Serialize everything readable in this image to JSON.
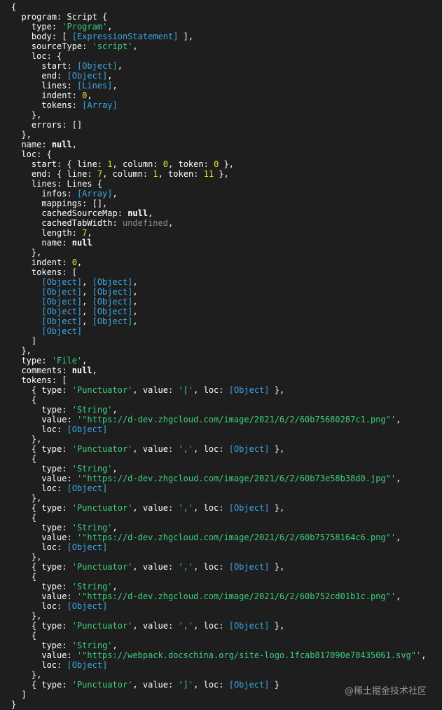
{
  "watermark": "@稀土掘金技术社区",
  "lines": [
    [
      [
        "p",
        "{"
      ]
    ],
    [
      [
        "p",
        "  "
      ],
      [
        "k",
        "program"
      ],
      [
        "p",
        ": Script {"
      ]
    ],
    [
      [
        "p",
        "    "
      ],
      [
        "k",
        "type"
      ],
      [
        "p",
        ": "
      ],
      [
        "s",
        "'Program'"
      ],
      [
        "p",
        ","
      ]
    ],
    [
      [
        "p",
        "    "
      ],
      [
        "k",
        "body"
      ],
      [
        "p",
        ": [ "
      ],
      [
        "r",
        "[ExpressionStatement]"
      ],
      [
        "p",
        " ],"
      ]
    ],
    [
      [
        "p",
        "    "
      ],
      [
        "k",
        "sourceType"
      ],
      [
        "p",
        ": "
      ],
      [
        "s",
        "'script'"
      ],
      [
        "p",
        ","
      ]
    ],
    [
      [
        "p",
        "    "
      ],
      [
        "k",
        "loc"
      ],
      [
        "p",
        ": {"
      ]
    ],
    [
      [
        "p",
        "      "
      ],
      [
        "k",
        "start"
      ],
      [
        "p",
        ": "
      ],
      [
        "r",
        "[Object]"
      ],
      [
        "p",
        ","
      ]
    ],
    [
      [
        "p",
        "      "
      ],
      [
        "k",
        "end"
      ],
      [
        "p",
        ": "
      ],
      [
        "r",
        "[Object]"
      ],
      [
        "p",
        ","
      ]
    ],
    [
      [
        "p",
        "      "
      ],
      [
        "k",
        "lines"
      ],
      [
        "p",
        ": "
      ],
      [
        "r",
        "[Lines]"
      ],
      [
        "p",
        ","
      ]
    ],
    [
      [
        "p",
        "      "
      ],
      [
        "k",
        "indent"
      ],
      [
        "p",
        ": "
      ],
      [
        "n",
        "0"
      ],
      [
        "p",
        ","
      ]
    ],
    [
      [
        "p",
        "      "
      ],
      [
        "k",
        "tokens"
      ],
      [
        "p",
        ": "
      ],
      [
        "r",
        "[Array]"
      ]
    ],
    [
      [
        "p",
        "    },"
      ]
    ],
    [
      [
        "p",
        "    "
      ],
      [
        "k",
        "errors"
      ],
      [
        "p",
        ": []"
      ]
    ],
    [
      [
        "p",
        "  },"
      ]
    ],
    [
      [
        "p",
        "  "
      ],
      [
        "k",
        "name"
      ],
      [
        "p",
        ": "
      ],
      [
        "kw",
        "null"
      ],
      [
        "p",
        ","
      ]
    ],
    [
      [
        "p",
        "  "
      ],
      [
        "k",
        "loc"
      ],
      [
        "p",
        ": {"
      ]
    ],
    [
      [
        "p",
        "    "
      ],
      [
        "k",
        "start"
      ],
      [
        "p",
        ": { "
      ],
      [
        "k",
        "line"
      ],
      [
        "p",
        ": "
      ],
      [
        "n",
        "1"
      ],
      [
        "p",
        ", "
      ],
      [
        "k",
        "column"
      ],
      [
        "p",
        ": "
      ],
      [
        "n",
        "0"
      ],
      [
        "p",
        ", "
      ],
      [
        "k",
        "token"
      ],
      [
        "p",
        ": "
      ],
      [
        "n",
        "0"
      ],
      [
        "p",
        " },"
      ]
    ],
    [
      [
        "p",
        "    "
      ],
      [
        "k",
        "end"
      ],
      [
        "p",
        ": { "
      ],
      [
        "k",
        "line"
      ],
      [
        "p",
        ": "
      ],
      [
        "n",
        "7"
      ],
      [
        "p",
        ", "
      ],
      [
        "k",
        "column"
      ],
      [
        "p",
        ": "
      ],
      [
        "n",
        "1"
      ],
      [
        "p",
        ", "
      ],
      [
        "k",
        "token"
      ],
      [
        "p",
        ": "
      ],
      [
        "n",
        "11"
      ],
      [
        "p",
        " },"
      ]
    ],
    [
      [
        "p",
        "    "
      ],
      [
        "k",
        "lines"
      ],
      [
        "p",
        ": Lines {"
      ]
    ],
    [
      [
        "p",
        "      "
      ],
      [
        "k",
        "infos"
      ],
      [
        "p",
        ": "
      ],
      [
        "r",
        "[Array]"
      ],
      [
        "p",
        ","
      ]
    ],
    [
      [
        "p",
        "      "
      ],
      [
        "k",
        "mappings"
      ],
      [
        "p",
        ": [],"
      ]
    ],
    [
      [
        "p",
        "      "
      ],
      [
        "k",
        "cachedSourceMap"
      ],
      [
        "p",
        ": "
      ],
      [
        "kw",
        "null"
      ],
      [
        "p",
        ","
      ]
    ],
    [
      [
        "p",
        "      "
      ],
      [
        "k",
        "cachedTabWidth"
      ],
      [
        "p",
        ": "
      ],
      [
        "u",
        "undefined"
      ],
      [
        "p",
        ","
      ]
    ],
    [
      [
        "p",
        "      "
      ],
      [
        "k",
        "length"
      ],
      [
        "p",
        ": "
      ],
      [
        "n",
        "7"
      ],
      [
        "p",
        ","
      ]
    ],
    [
      [
        "p",
        "      "
      ],
      [
        "k",
        "name"
      ],
      [
        "p",
        ": "
      ],
      [
        "kw",
        "null"
      ]
    ],
    [
      [
        "p",
        "    },"
      ]
    ],
    [
      [
        "p",
        "    "
      ],
      [
        "k",
        "indent"
      ],
      [
        "p",
        ": "
      ],
      [
        "n",
        "0"
      ],
      [
        "p",
        ","
      ]
    ],
    [
      [
        "p",
        "    "
      ],
      [
        "k",
        "tokens"
      ],
      [
        "p",
        ": ["
      ]
    ],
    [
      [
        "p",
        "      "
      ],
      [
        "r",
        "[Object]"
      ],
      [
        "p",
        ", "
      ],
      [
        "r",
        "[Object]"
      ],
      [
        "p",
        ","
      ]
    ],
    [
      [
        "p",
        "      "
      ],
      [
        "r",
        "[Object]"
      ],
      [
        "p",
        ", "
      ],
      [
        "r",
        "[Object]"
      ],
      [
        "p",
        ","
      ]
    ],
    [
      [
        "p",
        "      "
      ],
      [
        "r",
        "[Object]"
      ],
      [
        "p",
        ", "
      ],
      [
        "r",
        "[Object]"
      ],
      [
        "p",
        ","
      ]
    ],
    [
      [
        "p",
        "      "
      ],
      [
        "r",
        "[Object]"
      ],
      [
        "p",
        ", "
      ],
      [
        "r",
        "[Object]"
      ],
      [
        "p",
        ","
      ]
    ],
    [
      [
        "p",
        "      "
      ],
      [
        "r",
        "[Object]"
      ],
      [
        "p",
        ", "
      ],
      [
        "r",
        "[Object]"
      ],
      [
        "p",
        ","
      ]
    ],
    [
      [
        "p",
        "      "
      ],
      [
        "r",
        "[Object]"
      ]
    ],
    [
      [
        "p",
        "    ]"
      ]
    ],
    [
      [
        "p",
        "  },"
      ]
    ],
    [
      [
        "p",
        "  "
      ],
      [
        "k",
        "type"
      ],
      [
        "p",
        ": "
      ],
      [
        "s",
        "'File'"
      ],
      [
        "p",
        ","
      ]
    ],
    [
      [
        "p",
        "  "
      ],
      [
        "k",
        "comments"
      ],
      [
        "p",
        ": "
      ],
      [
        "kw",
        "null"
      ],
      [
        "p",
        ","
      ]
    ],
    [
      [
        "p",
        "  "
      ],
      [
        "k",
        "tokens"
      ],
      [
        "p",
        ": ["
      ]
    ],
    [
      [
        "p",
        "    { "
      ],
      [
        "k",
        "type"
      ],
      [
        "p",
        ": "
      ],
      [
        "s",
        "'Punctuator'"
      ],
      [
        "p",
        ", "
      ],
      [
        "k",
        "value"
      ],
      [
        "p",
        ": "
      ],
      [
        "s",
        "'['"
      ],
      [
        "p",
        ", "
      ],
      [
        "k",
        "loc"
      ],
      [
        "p",
        ": "
      ],
      [
        "r",
        "[Object]"
      ],
      [
        "p",
        " },"
      ]
    ],
    [
      [
        "p",
        "    {"
      ]
    ],
    [
      [
        "p",
        "      "
      ],
      [
        "k",
        "type"
      ],
      [
        "p",
        ": "
      ],
      [
        "s",
        "'String'"
      ],
      [
        "p",
        ","
      ]
    ],
    [
      [
        "p",
        "      "
      ],
      [
        "k",
        "value"
      ],
      [
        "p",
        ": "
      ],
      [
        "s",
        "'\"https://d-dev.zhgcloud.com/image/2021/6/2/60b75680287c1.png\"'"
      ],
      [
        "p",
        ","
      ]
    ],
    [
      [
        "p",
        "      "
      ],
      [
        "k",
        "loc"
      ],
      [
        "p",
        ": "
      ],
      [
        "r",
        "[Object]"
      ]
    ],
    [
      [
        "p",
        "    },"
      ]
    ],
    [
      [
        "p",
        "    { "
      ],
      [
        "k",
        "type"
      ],
      [
        "p",
        ": "
      ],
      [
        "s",
        "'Punctuator'"
      ],
      [
        "p",
        ", "
      ],
      [
        "k",
        "value"
      ],
      [
        "p",
        ": "
      ],
      [
        "s",
        "','"
      ],
      [
        "p",
        ", "
      ],
      [
        "k",
        "loc"
      ],
      [
        "p",
        ": "
      ],
      [
        "r",
        "[Object]"
      ],
      [
        "p",
        " },"
      ]
    ],
    [
      [
        "p",
        "    {"
      ]
    ],
    [
      [
        "p",
        "      "
      ],
      [
        "k",
        "type"
      ],
      [
        "p",
        ": "
      ],
      [
        "s",
        "'String'"
      ],
      [
        "p",
        ","
      ]
    ],
    [
      [
        "p",
        "      "
      ],
      [
        "k",
        "value"
      ],
      [
        "p",
        ": "
      ],
      [
        "s",
        "'\"https://d-dev.zhgcloud.com/image/2021/6/2/60b73e58b38d0.jpg\"'"
      ],
      [
        "p",
        ","
      ]
    ],
    [
      [
        "p",
        "      "
      ],
      [
        "k",
        "loc"
      ],
      [
        "p",
        ": "
      ],
      [
        "r",
        "[Object]"
      ]
    ],
    [
      [
        "p",
        "    },"
      ]
    ],
    [
      [
        "p",
        "    { "
      ],
      [
        "k",
        "type"
      ],
      [
        "p",
        ": "
      ],
      [
        "s",
        "'Punctuator'"
      ],
      [
        "p",
        ", "
      ],
      [
        "k",
        "value"
      ],
      [
        "p",
        ": "
      ],
      [
        "s",
        "','"
      ],
      [
        "p",
        ", "
      ],
      [
        "k",
        "loc"
      ],
      [
        "p",
        ": "
      ],
      [
        "r",
        "[Object]"
      ],
      [
        "p",
        " },"
      ]
    ],
    [
      [
        "p",
        "    {"
      ]
    ],
    [
      [
        "p",
        "      "
      ],
      [
        "k",
        "type"
      ],
      [
        "p",
        ": "
      ],
      [
        "s",
        "'String'"
      ],
      [
        "p",
        ","
      ]
    ],
    [
      [
        "p",
        "      "
      ],
      [
        "k",
        "value"
      ],
      [
        "p",
        ": "
      ],
      [
        "s",
        "'\"https://d-dev.zhgcloud.com/image/2021/6/2/60b75758164c6.png\"'"
      ],
      [
        "p",
        ","
      ]
    ],
    [
      [
        "p",
        "      "
      ],
      [
        "k",
        "loc"
      ],
      [
        "p",
        ": "
      ],
      [
        "r",
        "[Object]"
      ]
    ],
    [
      [
        "p",
        "    },"
      ]
    ],
    [
      [
        "p",
        "    { "
      ],
      [
        "k",
        "type"
      ],
      [
        "p",
        ": "
      ],
      [
        "s",
        "'Punctuator'"
      ],
      [
        "p",
        ", "
      ],
      [
        "k",
        "value"
      ],
      [
        "p",
        ": "
      ],
      [
        "s",
        "','"
      ],
      [
        "p",
        ", "
      ],
      [
        "k",
        "loc"
      ],
      [
        "p",
        ": "
      ],
      [
        "r",
        "[Object]"
      ],
      [
        "p",
        " },"
      ]
    ],
    [
      [
        "p",
        "    {"
      ]
    ],
    [
      [
        "p",
        "      "
      ],
      [
        "k",
        "type"
      ],
      [
        "p",
        ": "
      ],
      [
        "s",
        "'String'"
      ],
      [
        "p",
        ","
      ]
    ],
    [
      [
        "p",
        "      "
      ],
      [
        "k",
        "value"
      ],
      [
        "p",
        ": "
      ],
      [
        "s",
        "'\"https://d-dev.zhgcloud.com/image/2021/6/2/60b752cd01b1c.png\"'"
      ],
      [
        "p",
        ","
      ]
    ],
    [
      [
        "p",
        "      "
      ],
      [
        "k",
        "loc"
      ],
      [
        "p",
        ": "
      ],
      [
        "r",
        "[Object]"
      ]
    ],
    [
      [
        "p",
        "    },"
      ]
    ],
    [
      [
        "p",
        "    { "
      ],
      [
        "k",
        "type"
      ],
      [
        "p",
        ": "
      ],
      [
        "s",
        "'Punctuator'"
      ],
      [
        "p",
        ", "
      ],
      [
        "k",
        "value"
      ],
      [
        "p",
        ": "
      ],
      [
        "s",
        "','"
      ],
      [
        "p",
        ", "
      ],
      [
        "k",
        "loc"
      ],
      [
        "p",
        ": "
      ],
      [
        "r",
        "[Object]"
      ],
      [
        "p",
        " },"
      ]
    ],
    [
      [
        "p",
        "    {"
      ]
    ],
    [
      [
        "p",
        "      "
      ],
      [
        "k",
        "type"
      ],
      [
        "p",
        ": "
      ],
      [
        "s",
        "'String'"
      ],
      [
        "p",
        ","
      ]
    ],
    [
      [
        "p",
        "      "
      ],
      [
        "k",
        "value"
      ],
      [
        "p",
        ": "
      ],
      [
        "s",
        "'\"https://webpack.docschina.org/site-logo.1fcab817090e78435061.svg\"'"
      ],
      [
        "p",
        ","
      ]
    ],
    [
      [
        "p",
        "      "
      ],
      [
        "k",
        "loc"
      ],
      [
        "p",
        ": "
      ],
      [
        "r",
        "[Object]"
      ]
    ],
    [
      [
        "p",
        "    },"
      ]
    ],
    [
      [
        "p",
        "    { "
      ],
      [
        "k",
        "type"
      ],
      [
        "p",
        ": "
      ],
      [
        "s",
        "'Punctuator'"
      ],
      [
        "p",
        ", "
      ],
      [
        "k",
        "value"
      ],
      [
        "p",
        ": "
      ],
      [
        "s",
        "']'"
      ],
      [
        "p",
        ", "
      ],
      [
        "k",
        "loc"
      ],
      [
        "p",
        ": "
      ],
      [
        "r",
        "[Object]"
      ],
      [
        "p",
        " }"
      ]
    ],
    [
      [
        "p",
        "  ]"
      ]
    ],
    [
      [
        "p",
        "}"
      ]
    ]
  ]
}
